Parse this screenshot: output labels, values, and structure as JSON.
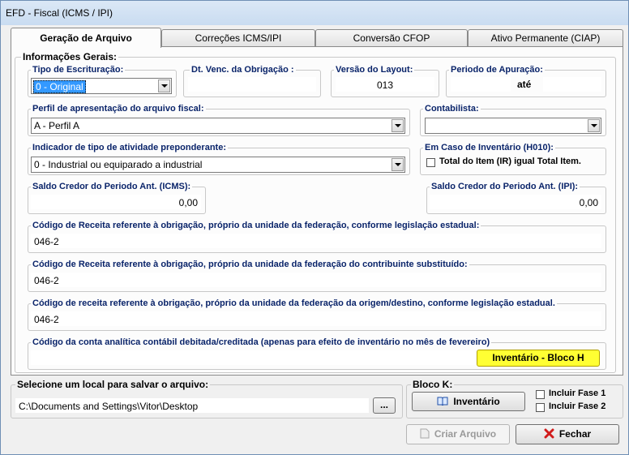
{
  "window": {
    "title": "EFD - Fiscal (ICMS / IPI)"
  },
  "tabs": [
    {
      "label": "Geração de Arquivo"
    },
    {
      "label": "Correções ICMS/IPI"
    },
    {
      "label": "Conversão CFOP"
    },
    {
      "label": "Ativo Permanente (CIAP)"
    }
  ],
  "general": {
    "legend": "Informações Gerais:",
    "tipo_escrituracao": {
      "label": "Tipo de Escrituração:",
      "value": "0 - Original"
    },
    "dt_venc": {
      "label": "Dt. Venc. da Obrigação :",
      "value": ""
    },
    "versao_layout": {
      "label": "Versão do Layout:",
      "value": "013"
    },
    "periodo_apuracao": {
      "label": "Periodo de Apuração:",
      "ate": "até",
      "from": "",
      "to": ""
    },
    "perfil": {
      "label": "Perfil de apresentação do arquivo fiscal:",
      "value": "A - Perfil A"
    },
    "contabilista": {
      "label": "Contabilista:",
      "value": ""
    },
    "indicador": {
      "label": "Indicador de tipo de atividade preponderante:",
      "value": "0 - Industrial ou equiparado a industrial"
    },
    "inventario_h010": {
      "label": "Em Caso de Inventário (H010):",
      "checkbox_label": "Total do Item (IR) igual Total Item."
    },
    "saldo_icms": {
      "label": "Saldo Credor do Periodo Ant. (ICMS):",
      "value": "0,00"
    },
    "saldo_ipi": {
      "label": "Saldo Credor do Periodo Ant. (IPI):",
      "value": "0,00"
    },
    "cod_receita_estadual": {
      "label": "Código de Receita referente à obrigação, próprio da unidade da federação, conforme legislação estadual:",
      "value": "046-2"
    },
    "cod_receita_substituido": {
      "label": "Código de Receita referente à obrigação, próprio da unidade da federação do contribuinte substituído:",
      "value": "046-2"
    },
    "cod_receita_origem": {
      "label": "Código de receita referente à obrigação, próprio da unidade da federação da origem/destino, conforme legislação estadual.",
      "value": "046-2"
    },
    "conta_analitica": {
      "label": "Código da conta analítica contábil debitada/creditada (apenas para efeito de inventário no mês de fevereiro)",
      "value": ""
    },
    "btn_inventario_h": "Inventário - Bloco H"
  },
  "save": {
    "legend": "Selecione um local para salvar o arquivo:",
    "path": "C:\\Documents and Settings\\Vitor\\Desktop",
    "browse": "..."
  },
  "bloco_k": {
    "legend": "Bloco K:",
    "btn_inventario": "Inventário",
    "fase1": "Incluir Fase 1",
    "fase2": "Incluir Fase 2"
  },
  "actions": {
    "criar": "Criar Arquivo",
    "fechar": "Fechar"
  },
  "colors": {
    "accent_yellow": "#ffff33",
    "legend_blue": "#0a246a",
    "close_red": "#d11c1c"
  }
}
